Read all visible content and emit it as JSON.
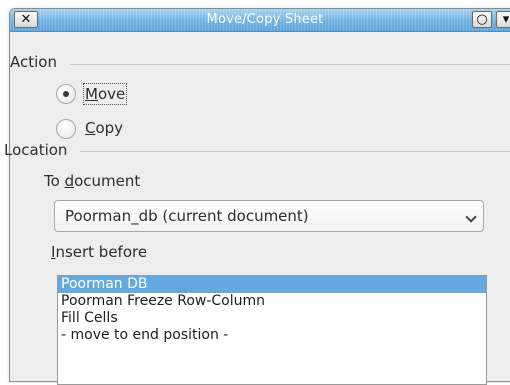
{
  "window": {
    "title": "Move/Copy Sheet",
    "close_icon": "✕",
    "minimize_icon": "○",
    "menu_icon": "▾"
  },
  "action": {
    "label": "Action",
    "options": [
      {
        "label_prefix": "",
        "label_mnemonic": "M",
        "label_rest": "ove",
        "checked": true
      },
      {
        "label_prefix": "",
        "label_mnemonic": "C",
        "label_rest": "opy",
        "checked": false
      }
    ]
  },
  "location": {
    "label": "Location",
    "to_document": {
      "label_prefix": "To ",
      "label_mnemonic": "d",
      "label_rest": "ocument"
    },
    "document_select": {
      "value": "Poorman_db (current document)"
    },
    "insert_before": {
      "label_prefix": "",
      "label_mnemonic": "I",
      "label_rest": "nsert before"
    },
    "sheets": [
      {
        "name": "Poorman DB",
        "selected": true
      },
      {
        "name": "Poorman Freeze Row-Column",
        "selected": false
      },
      {
        "name": "Fill Cells",
        "selected": false
      },
      {
        "name": "- move to end position -",
        "selected": false
      }
    ]
  },
  "colors": {
    "selection": "#62a9df",
    "titlebar": "#6fb0e0"
  }
}
